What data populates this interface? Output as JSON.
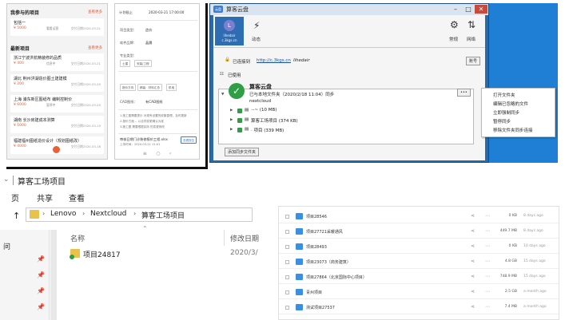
{
  "mobile_list": {
    "my_projects_title": "我参与的项目",
    "latest_title": "最新项目",
    "more": "查看更多",
    "my_projects": [
      {
        "name": "包括一",
        "price": "¥ 5000",
        "status": "看看运营",
        "date": "交付日期2020-03-21"
      }
    ],
    "latest": [
      {
        "name": "浙江宁波洪杭精装修的品质",
        "price": "¥ 400",
        "status": "信息中",
        "date": "交付日期2020-03-21"
      },
      {
        "name": "湖北 荆州洪湖造价图土建建模",
        "price": "¥ 200",
        "status": "",
        "date": "交付日期2020-03-20"
      },
      {
        "name": "上海 浦东新区图纸布 编制控制价",
        "price": "¥ 6000",
        "status": "暂停中",
        "date": "交付日期2020-03-20"
      },
      {
        "name": "湖南 长沙房建成本测算",
        "price": "¥ 1000",
        "status": "",
        "date": "交付日期2020-03-19"
      },
      {
        "name": "福建福州图纸造价设计（规划图纸改）",
        "price": "¥ 4000",
        "status": "",
        "date": "交付日期2020-03-18"
      }
    ]
  },
  "mobile_detail": {
    "top_label": "计划截止",
    "top_date": "2020-03-21 17:00:00",
    "rows": [
      {
        "label": "项目类型：",
        "value": "造价"
      },
      {
        "label": "软件品牌：",
        "value": "晶晨"
      },
      {
        "label": "专业类型：",
        "value": ""
      }
    ],
    "tags_a": [
      "土建",
      "安装/工程"
    ],
    "tags_b": [
      "报价方向",
      "精装 · 材料汇总",
      "机电"
    ],
    "cad_label": "CAD图纸：",
    "cad_value": "有CAD图纸",
    "notes": [
      "1.施工图需要提示 对现有设置的收集整理，及时更新",
      "2.报价方面 -- 以合同变更确认为准",
      "3.施工图 需要根据实际 的变更修改"
    ],
    "file_name": "审核日期门诊装修报价工程.xlsx",
    "file_date": "上传时间：2020-03-21 11:01",
    "file_action": "查看报告"
  },
  "sync_window": {
    "title": "算客云盘",
    "logo_text": "云盘",
    "account_line1": "lihedair",
    "account_line2": "c.3kgs.cn",
    "avatar_letter": "L",
    "tool_activity": "动态",
    "tool_settings": "常规",
    "tool_network": "网络",
    "connected_label": "已连接到",
    "connected_host": "http://c.3kgs.cn",
    "connected_user": "lihedair",
    "account_button": "账号",
    "usage_label": "已使用",
    "folder_title": "算客云盘",
    "sync_status": "已与本地文件夹（2020/2/18 11:04）同步",
    "remote_name": "nextcloud",
    "items": [
      {
        "name": "·–~ (10 MB)"
      },
      {
        "name": "算客工场项目 (374 KB)"
      },
      {
        "name": "· 项目 (339 MB)"
      }
    ],
    "add_sync_button": "添加同步文件夹",
    "more_button": "•••"
  },
  "context_menu": {
    "items": [
      "打开文件夹",
      "编辑已忽略的文件",
      "立即强制同步",
      "暂停同步",
      "移除文件夹同步连接"
    ]
  },
  "explorer": {
    "window_title": "算客工场项目",
    "ribbon_tabs": [
      "页",
      "共享",
      "查看"
    ],
    "path": [
      "Lenovo",
      "Nextcloud",
      "算客工场项目"
    ],
    "col_name": "名称",
    "col_date": "修改日期",
    "sidebar_label": "问",
    "files": [
      {
        "name": "项目24817",
        "date": "2020/3/"
      }
    ]
  },
  "file_list": {
    "rows": [
      {
        "name": "项目28546",
        "size": "0 KB",
        "date": "8 days ago"
      },
      {
        "name": "项目27721采暖通风",
        "size": "449.7 MB",
        "date": "8 days ago"
      },
      {
        "name": "项目28493",
        "size": "0 KB",
        "date": "10 days ago"
      },
      {
        "name": "项目23073（商务建筑）",
        "size": "4.8 GB",
        "date": "15 days ago"
      },
      {
        "name": "项目27864（北京国际中心项目）",
        "size": "748.9 MB",
        "date": "15 days ago"
      },
      {
        "name": "青州项目",
        "size": "2.5 GB",
        "date": "a month ago"
      },
      {
        "name": "测试项目27537",
        "size": "7.4 MB",
        "date": "a month ago"
      }
    ]
  },
  "colors": {
    "accent": "#e8603a",
    "window_blue": "#2a6aa8",
    "desktop_blue": "#1e7fd4",
    "check_green": "#2f9e44"
  }
}
